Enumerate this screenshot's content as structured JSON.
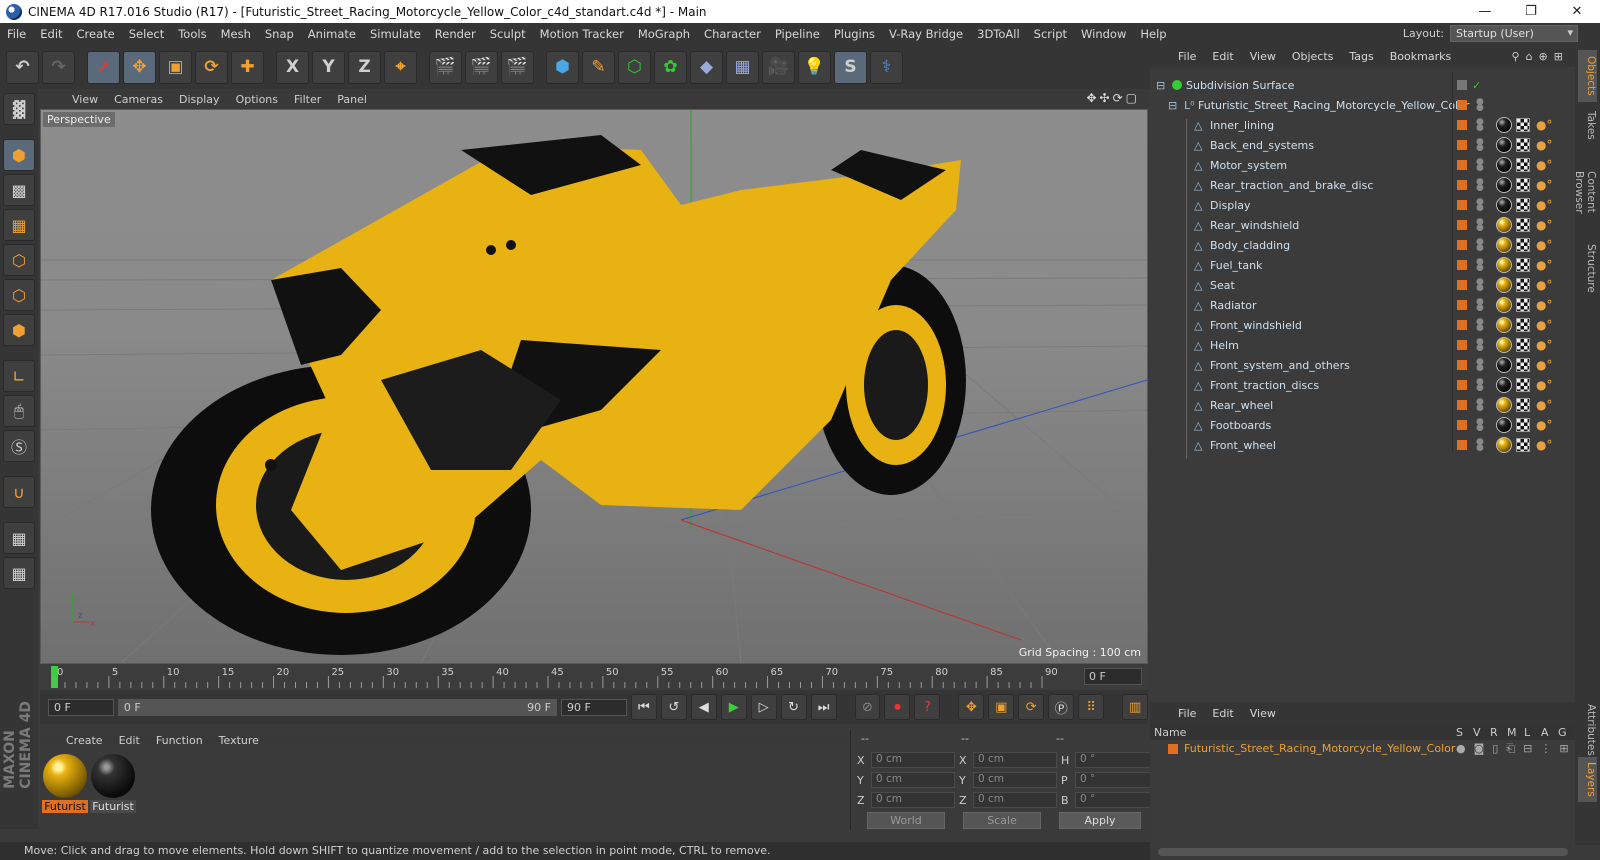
{
  "title_bar": {
    "text": "CINEMA 4D R17.016 Studio (R17) - [Futuristic_Street_Racing_Motorcycle_Yellow_Color_c4d_standart.c4d *] - Main",
    "minimize": "—",
    "maximize": "❐",
    "close": "✕"
  },
  "menu": [
    "File",
    "Edit",
    "Create",
    "Select",
    "Tools",
    "Mesh",
    "Snap",
    "Animate",
    "Simulate",
    "Render",
    "Sculpt",
    "Motion Tracker",
    "MoGraph",
    "Character",
    "Pipeline",
    "Plugins",
    "V-Ray Bridge",
    "3DToAll",
    "Script",
    "Window",
    "Help"
  ],
  "layout": {
    "label": "Layout:",
    "value": "Startup (User)"
  },
  "toolbar_axis": {
    "x": "X",
    "y": "Y",
    "z": "Z"
  },
  "viewport": {
    "menu": [
      "View",
      "Cameras",
      "Display",
      "Options",
      "Filter",
      "Panel"
    ],
    "nav_icons": "✥✣⟳▢",
    "label": "Perspective",
    "grid_spacing": "Grid Spacing : 100 cm",
    "axis_x": "x",
    "axis_y": "y",
    "axis_z": "z"
  },
  "timeline": {
    "ticks": [
      "0",
      "5",
      "10",
      "15",
      "20",
      "25",
      "30",
      "35",
      "40",
      "45",
      "50",
      "55",
      "60",
      "65",
      "70",
      "75",
      "80",
      "85",
      "90"
    ],
    "current_frame": "0 F",
    "start_field": "0 F",
    "range_start": "0 F",
    "range_end": "90 F",
    "end_field": "90 F"
  },
  "material_manager": {
    "menu": [
      "Create",
      "Edit",
      "Function",
      "Texture"
    ],
    "materials": [
      {
        "label": "Futurist",
        "kind": "yellow"
      },
      {
        "label": "Futurist",
        "kind": "black"
      }
    ]
  },
  "coordinates": {
    "headers": [
      "--",
      "--",
      "--"
    ],
    "rows": [
      {
        "a": "X",
        "av": "0 cm",
        "b": "X",
        "bv": "0 cm",
        "c": "H",
        "cv": "0 °"
      },
      {
        "a": "Y",
        "av": "0 cm",
        "b": "Y",
        "bv": "0 cm",
        "c": "P",
        "cv": "0 °"
      },
      {
        "a": "Z",
        "av": "0 cm",
        "b": "Z",
        "bv": "0 cm",
        "c": "B",
        "cv": "0 °"
      }
    ],
    "world": "World",
    "scale": "Scale",
    "apply": "Apply"
  },
  "status": "Move: Click and drag to move elements. Hold down SHIFT to quantize movement / add to the selection in point mode, CTRL to remove.",
  "object_manager": {
    "menu": [
      "File",
      "Edit",
      "View",
      "Objects",
      "Tags",
      "Bookmarks"
    ],
    "root": "Subdivision Surface",
    "group": "Futuristic_Street_Racing_Motorcycle_Yellow_Color",
    "objects": [
      {
        "name": "Inner_lining",
        "mat": "black"
      },
      {
        "name": "Back_end_systems",
        "mat": "black"
      },
      {
        "name": "Motor_system",
        "mat": "black"
      },
      {
        "name": "Rear_traction_and_brake_disc",
        "mat": "black"
      },
      {
        "name": "Display",
        "mat": "black"
      },
      {
        "name": "Rear_windshield",
        "mat": "yellow"
      },
      {
        "name": "Body_cladding",
        "mat": "yellow"
      },
      {
        "name": "Fuel_tank",
        "mat": "yellow"
      },
      {
        "name": "Seat",
        "mat": "yellow"
      },
      {
        "name": "Radiator",
        "mat": "yellow"
      },
      {
        "name": "Front_windshield",
        "mat": "yellow"
      },
      {
        "name": "Helm",
        "mat": "yellow"
      },
      {
        "name": "Front_system_and_others",
        "mat": "black"
      },
      {
        "name": "Front_traction_discs",
        "mat": "black"
      },
      {
        "name": "Rear_wheel",
        "mat": "yellow"
      },
      {
        "name": "Footboards",
        "mat": "black"
      },
      {
        "name": "Front_wheel",
        "mat": "yellow"
      }
    ]
  },
  "right_tabs": [
    "Objects",
    "Takes",
    "Content Browser",
    "Structure"
  ],
  "right_tabs_lower": [
    "Attributes",
    "Layers"
  ],
  "layer_manager": {
    "menu": [
      "File",
      "Edit",
      "View"
    ],
    "columns": {
      "name": "Name",
      "flags": [
        "S",
        "V",
        "R",
        "M",
        "L",
        "A",
        "G"
      ]
    },
    "row": "Futuristic_Street_Racing_Motorcycle_Yellow_Color"
  },
  "colors": {
    "accent_orange": "#e07020",
    "selection_text": "#f0a030",
    "object_text": "#cfe0ee",
    "bike_yellow": "#e8b212"
  }
}
